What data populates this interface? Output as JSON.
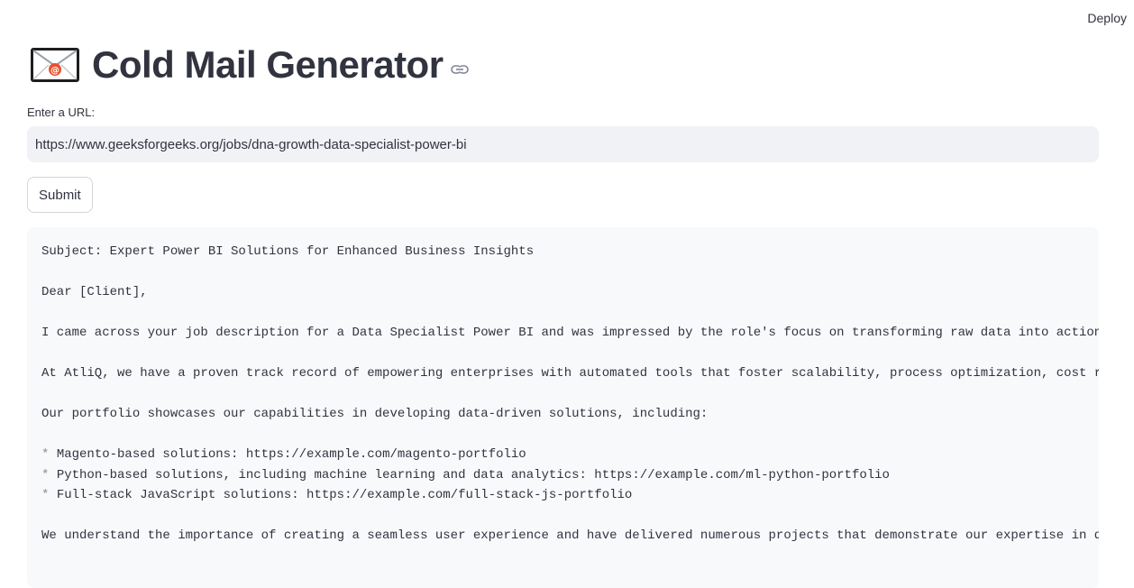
{
  "toolbar": {
    "deploy_label": "Deploy"
  },
  "header": {
    "title": "Cold Mail Generator",
    "title_icon": "envelope-icon",
    "anchor_icon": "link-icon"
  },
  "form": {
    "url_label": "Enter a URL:",
    "url_value": "https://www.geeksforgeeks.org/jobs/dna-growth-data-specialist-power-bi",
    "submit_label": "Submit"
  },
  "output": {
    "subject": "Subject: Expert Power BI Solutions for Enhanced Business Insights",
    "greeting": "Dear [Client],",
    "para1": "I came across your job description for a Data Specialist Power BI and was impressed by the role's focus on transforming raw data into actionable insights.",
    "para2": "At AtliQ, we have a proven track record of empowering enterprises with automated tools that foster scalability, process optimization, cost reduction, and heightened overall efficiency.",
    "para3": "Our portfolio showcases our capabilities in developing data-driven solutions, including:",
    "bullets": [
      "Magento-based solutions: https://example.com/magento-portfolio",
      "Python-based solutions, including machine learning and data analytics: https://example.com/ml-python-portfolio",
      "Full-stack JavaScript solutions: https://example.com/full-stack-js-portfolio"
    ],
    "para4": "We understand the importance of creating a seamless user experience and have delivered numerous projects that demonstrate our expertise in data visualization."
  },
  "colors": {
    "text": "#31333f",
    "input_bg": "#f0f2f6",
    "code_bg": "#f8f9fb",
    "accent": "#ff4b4b"
  }
}
